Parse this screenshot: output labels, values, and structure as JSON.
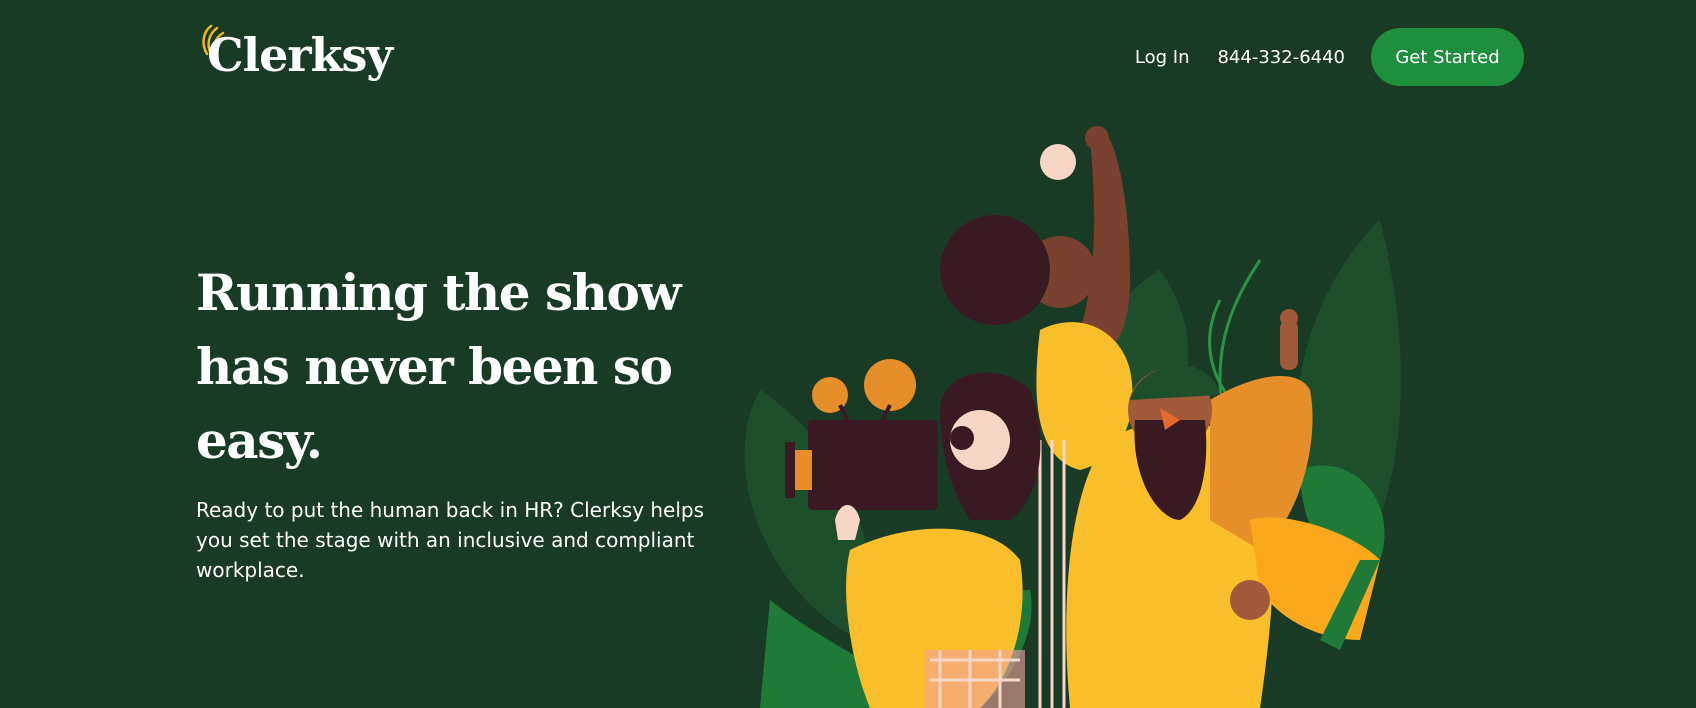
{
  "brand": {
    "name": "Clerksy",
    "mark_color": "#f0b429"
  },
  "nav": {
    "login_label": "Log In",
    "phone": "844-332-6440",
    "cta_label": "Get Started"
  },
  "hero": {
    "title": "Running the show has never been so easy.",
    "subtitle": "Ready to put the human back in HR? Clerksy helps you set the stage with an inclusive and compliant workplace."
  },
  "colors": {
    "background": "#193b26",
    "cta": "#1f8e3d",
    "text": "#ffffff"
  }
}
